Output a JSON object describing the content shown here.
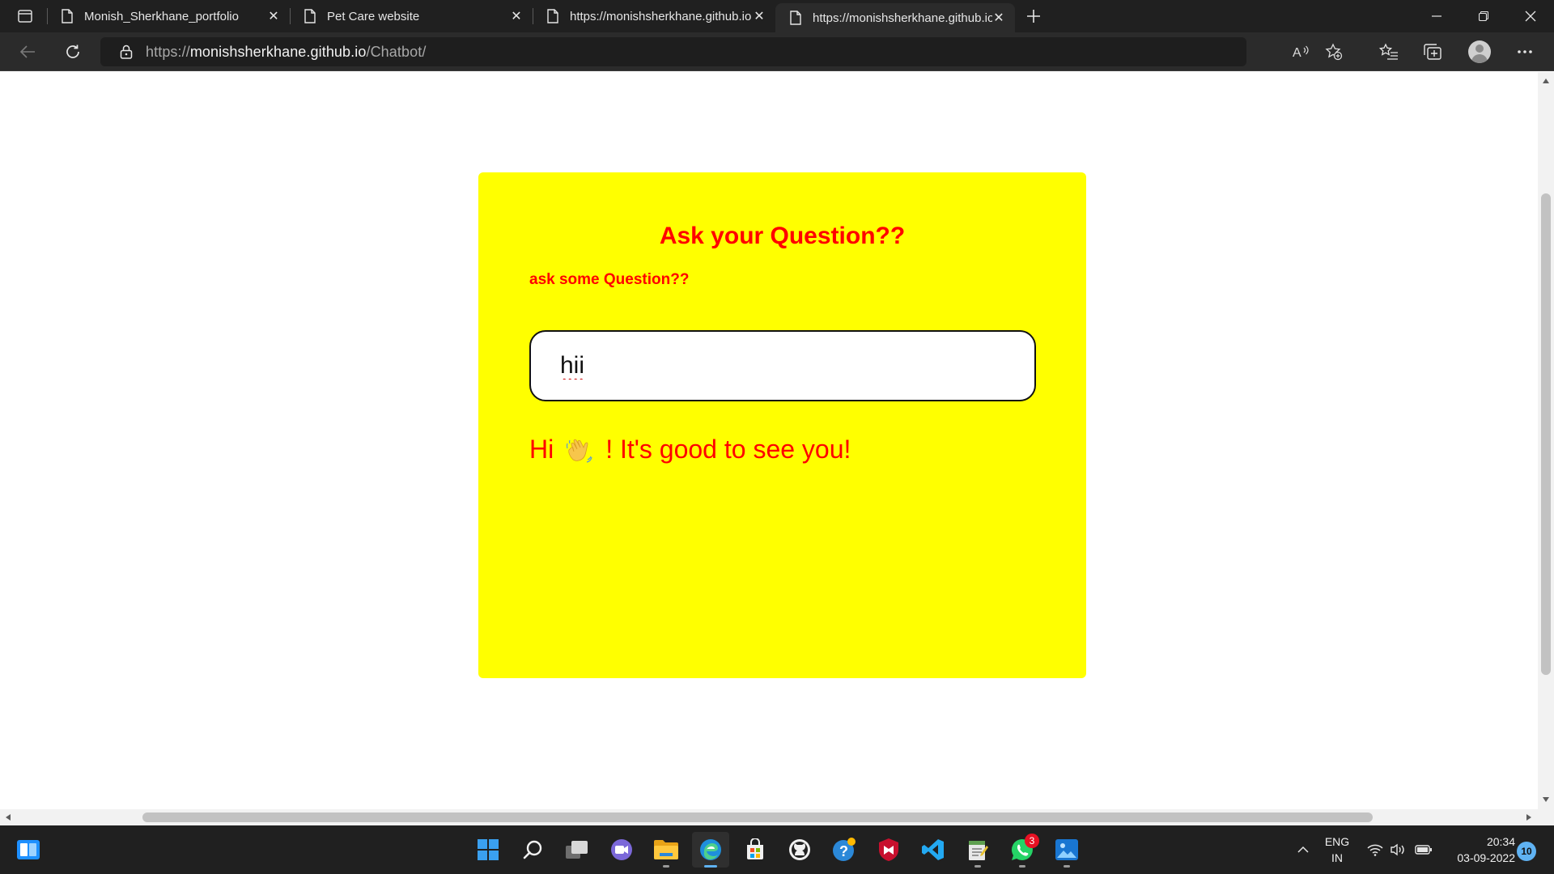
{
  "browser": {
    "tabs": [
      {
        "title": "Monish_Sherkhane_portfolio",
        "active": false
      },
      {
        "title": "Pet Care website",
        "active": false
      },
      {
        "title": "https://monishsherkhane.github.io",
        "active": false
      },
      {
        "title": "https://monishsherkhane.github.io",
        "active": true
      }
    ],
    "address": {
      "scheme": "https://",
      "host": "monishsherkhane.github.io",
      "path": "/Chatbot/"
    }
  },
  "chat": {
    "title": "Ask your Question??",
    "subtitle": "ask some Question??",
    "input_value": "hii",
    "reply_before": "Hi",
    "reply_after": "! It's good to see you!",
    "colors": {
      "card": "#ffff00",
      "text": "#ff0000"
    }
  },
  "taskbar": {
    "apps": [
      {
        "name": "start-icon"
      },
      {
        "name": "search-icon"
      },
      {
        "name": "task-view-icon"
      },
      {
        "name": "teams-chat-icon"
      },
      {
        "name": "file-explorer-icon"
      },
      {
        "name": "edge-icon"
      },
      {
        "name": "store-icon"
      },
      {
        "name": "github-desktop-icon"
      },
      {
        "name": "help-icon"
      },
      {
        "name": "mcafee-icon"
      },
      {
        "name": "vscode-icon"
      },
      {
        "name": "notepad-icon"
      },
      {
        "name": "whatsapp-icon",
        "badge": "3"
      },
      {
        "name": "photos-icon"
      }
    ],
    "tray": {
      "lang_line1": "ENG",
      "lang_line2": "IN",
      "time": "20:34",
      "date": "03-09-2022",
      "notifications": "10"
    }
  }
}
